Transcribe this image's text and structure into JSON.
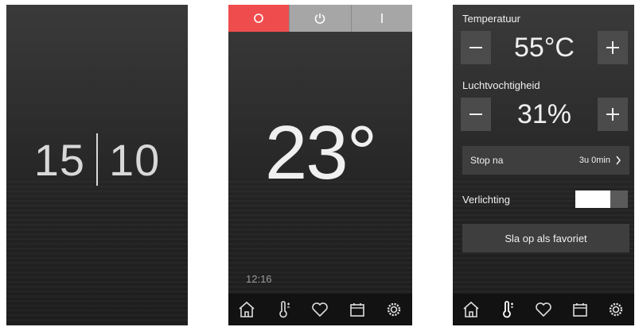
{
  "screen1": {
    "clock": {
      "hours": "15",
      "minutes": "10"
    }
  },
  "screen2": {
    "mode_buttons": [
      {
        "icon": "circle-icon",
        "active": true
      },
      {
        "icon": "power-icon",
        "active": false
      },
      {
        "icon": "line-icon",
        "active": false
      }
    ],
    "temperature": "23°",
    "time": "12:16"
  },
  "screen3": {
    "temperature_label": "Temperatuur",
    "temperature_value": "55°C",
    "humidity_label": "Luchtvochtigheid",
    "humidity_value": "31%",
    "stop_label": "Stop na",
    "stop_value": "3u 0min",
    "lighting_label": "Verlichting",
    "lighting_on": true,
    "favorite_button": "Sla op als favoriet"
  },
  "navbar_icons": [
    "home-icon",
    "thermometer-icon",
    "heart-icon",
    "calendar-icon",
    "settings-icon"
  ],
  "colors": {
    "accent_red": "#ef4d4d",
    "mode_gray": "#a6a6a6",
    "navbar_bg": "#121212"
  }
}
